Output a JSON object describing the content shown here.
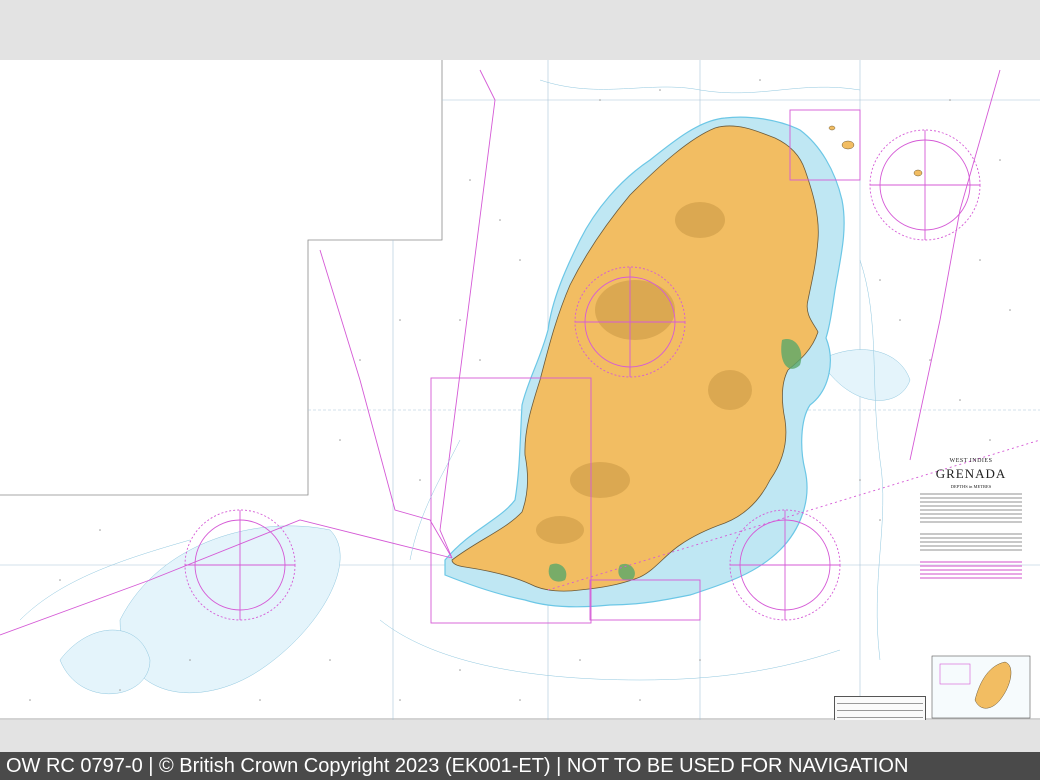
{
  "footer": {
    "text": "OW RC 0797-0 | © British Crown Copyright 2023 (EK001-ET) | NOT TO BE USED FOR NAVIGATION"
  },
  "title_block": {
    "region": "WEST INDIES",
    "name": "GRENADA",
    "subtitle": "DEPTHS in METRES"
  },
  "colors": {
    "land": "#f2bd62",
    "land_dark": "#c99744",
    "shallow_water": "#bfe7f3",
    "medium_water": "#dff3fa",
    "coast_blue": "#6cc7e6",
    "magenta_lines": "#d55ad6",
    "grid_lines": "#a8c4d8",
    "footer_bg": "#4a4a4a",
    "band_bg": "#e3e3e3"
  },
  "icons": [
    "compass-rose-icon"
  ]
}
